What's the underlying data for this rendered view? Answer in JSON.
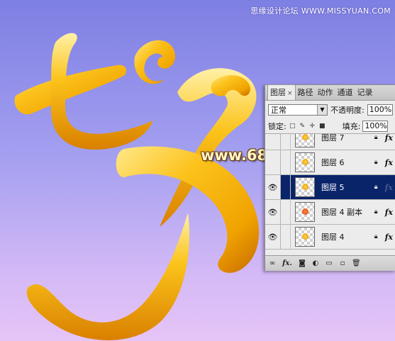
{
  "watermark": {
    "top": "思缘设计论坛 WWW.MISSYUAN.COM",
    "site": "www.68ps.com"
  },
  "panel": {
    "tabs": [
      {
        "label": "图层",
        "close": "×"
      },
      {
        "label": "路径"
      },
      {
        "label": "动作"
      },
      {
        "label": "通道"
      },
      {
        "label": "记录"
      }
    ],
    "blend_mode": "正常",
    "opacity_label": "不透明度:",
    "opacity_value": "100%",
    "lock_label": "锁定:",
    "fill_label": "填充:",
    "fill_value": "100%",
    "layers": [
      {
        "name": "图层 7",
        "visible": false,
        "selected": false
      },
      {
        "name": "图层 6",
        "visible": false,
        "selected": false
      },
      {
        "name": "图层 5",
        "visible": true,
        "selected": true
      },
      {
        "name": "图层 4 副本",
        "visible": true,
        "selected": false
      },
      {
        "name": "图层 4",
        "visible": true,
        "selected": false
      }
    ],
    "fx_label": "fx",
    "bottom_fx": "fx."
  },
  "colors": {
    "bg_top": "#7e7fe3",
    "bg_bottom": "#e6c4f7",
    "gold": "#f5b800",
    "selection": "#0a246a"
  }
}
